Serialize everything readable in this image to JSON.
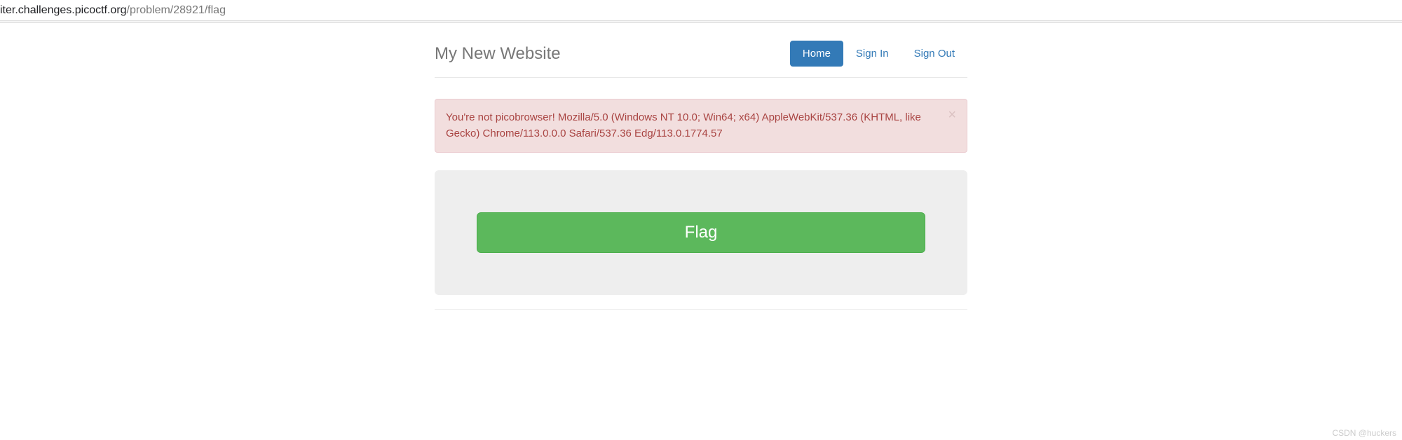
{
  "url": {
    "domain": "iter.challenges.picoctf.org",
    "path": "/problem/28921/flag"
  },
  "navbar": {
    "brand": "My New Website",
    "items": [
      {
        "label": "Home",
        "active": true
      },
      {
        "label": "Sign In",
        "active": false
      },
      {
        "label": "Sign Out",
        "active": false
      }
    ]
  },
  "alert": {
    "message": "You're not picobrowser! Mozilla/5.0 (Windows NT 10.0; Win64; x64) AppleWebKit/537.36 (KHTML, like Gecko) Chrome/113.0.0.0 Safari/537.36 Edg/113.0.1774.57",
    "close_symbol": "×"
  },
  "main": {
    "flag_button_label": "Flag"
  },
  "watermark": "CSDN @huckers"
}
